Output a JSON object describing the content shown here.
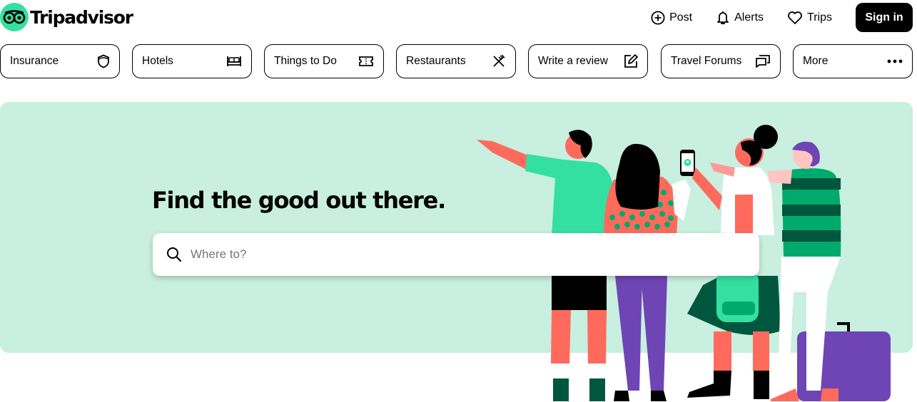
{
  "header": {
    "brand": "Tripadvisor",
    "nav": [
      {
        "label": "Post",
        "icon": "plus-circle-icon"
      },
      {
        "label": "Alerts",
        "icon": "bell-icon"
      },
      {
        "label": "Trips",
        "icon": "heart-icon"
      }
    ],
    "signin_label": "Sign in"
  },
  "categories": [
    {
      "label": "Insurance",
      "icon": "shield-icon"
    },
    {
      "label": "Hotels",
      "icon": "bed-icon"
    },
    {
      "label": "Things to Do",
      "icon": "ticket-icon"
    },
    {
      "label": "Restaurants",
      "icon": "fork-knife-icon"
    },
    {
      "label": "Write a review",
      "icon": "edit-icon"
    },
    {
      "label": "Travel Forums",
      "icon": "chat-icon"
    },
    {
      "label": "More",
      "icon": "more-dots-icon"
    }
  ],
  "hero": {
    "title": "Find the good out there.",
    "search": {
      "placeholder": "Where to?",
      "value": ""
    }
  },
  "colors": {
    "brand_green": "#34e0a1",
    "hero_background": "#c8efe0",
    "button_dark": "#000000"
  }
}
